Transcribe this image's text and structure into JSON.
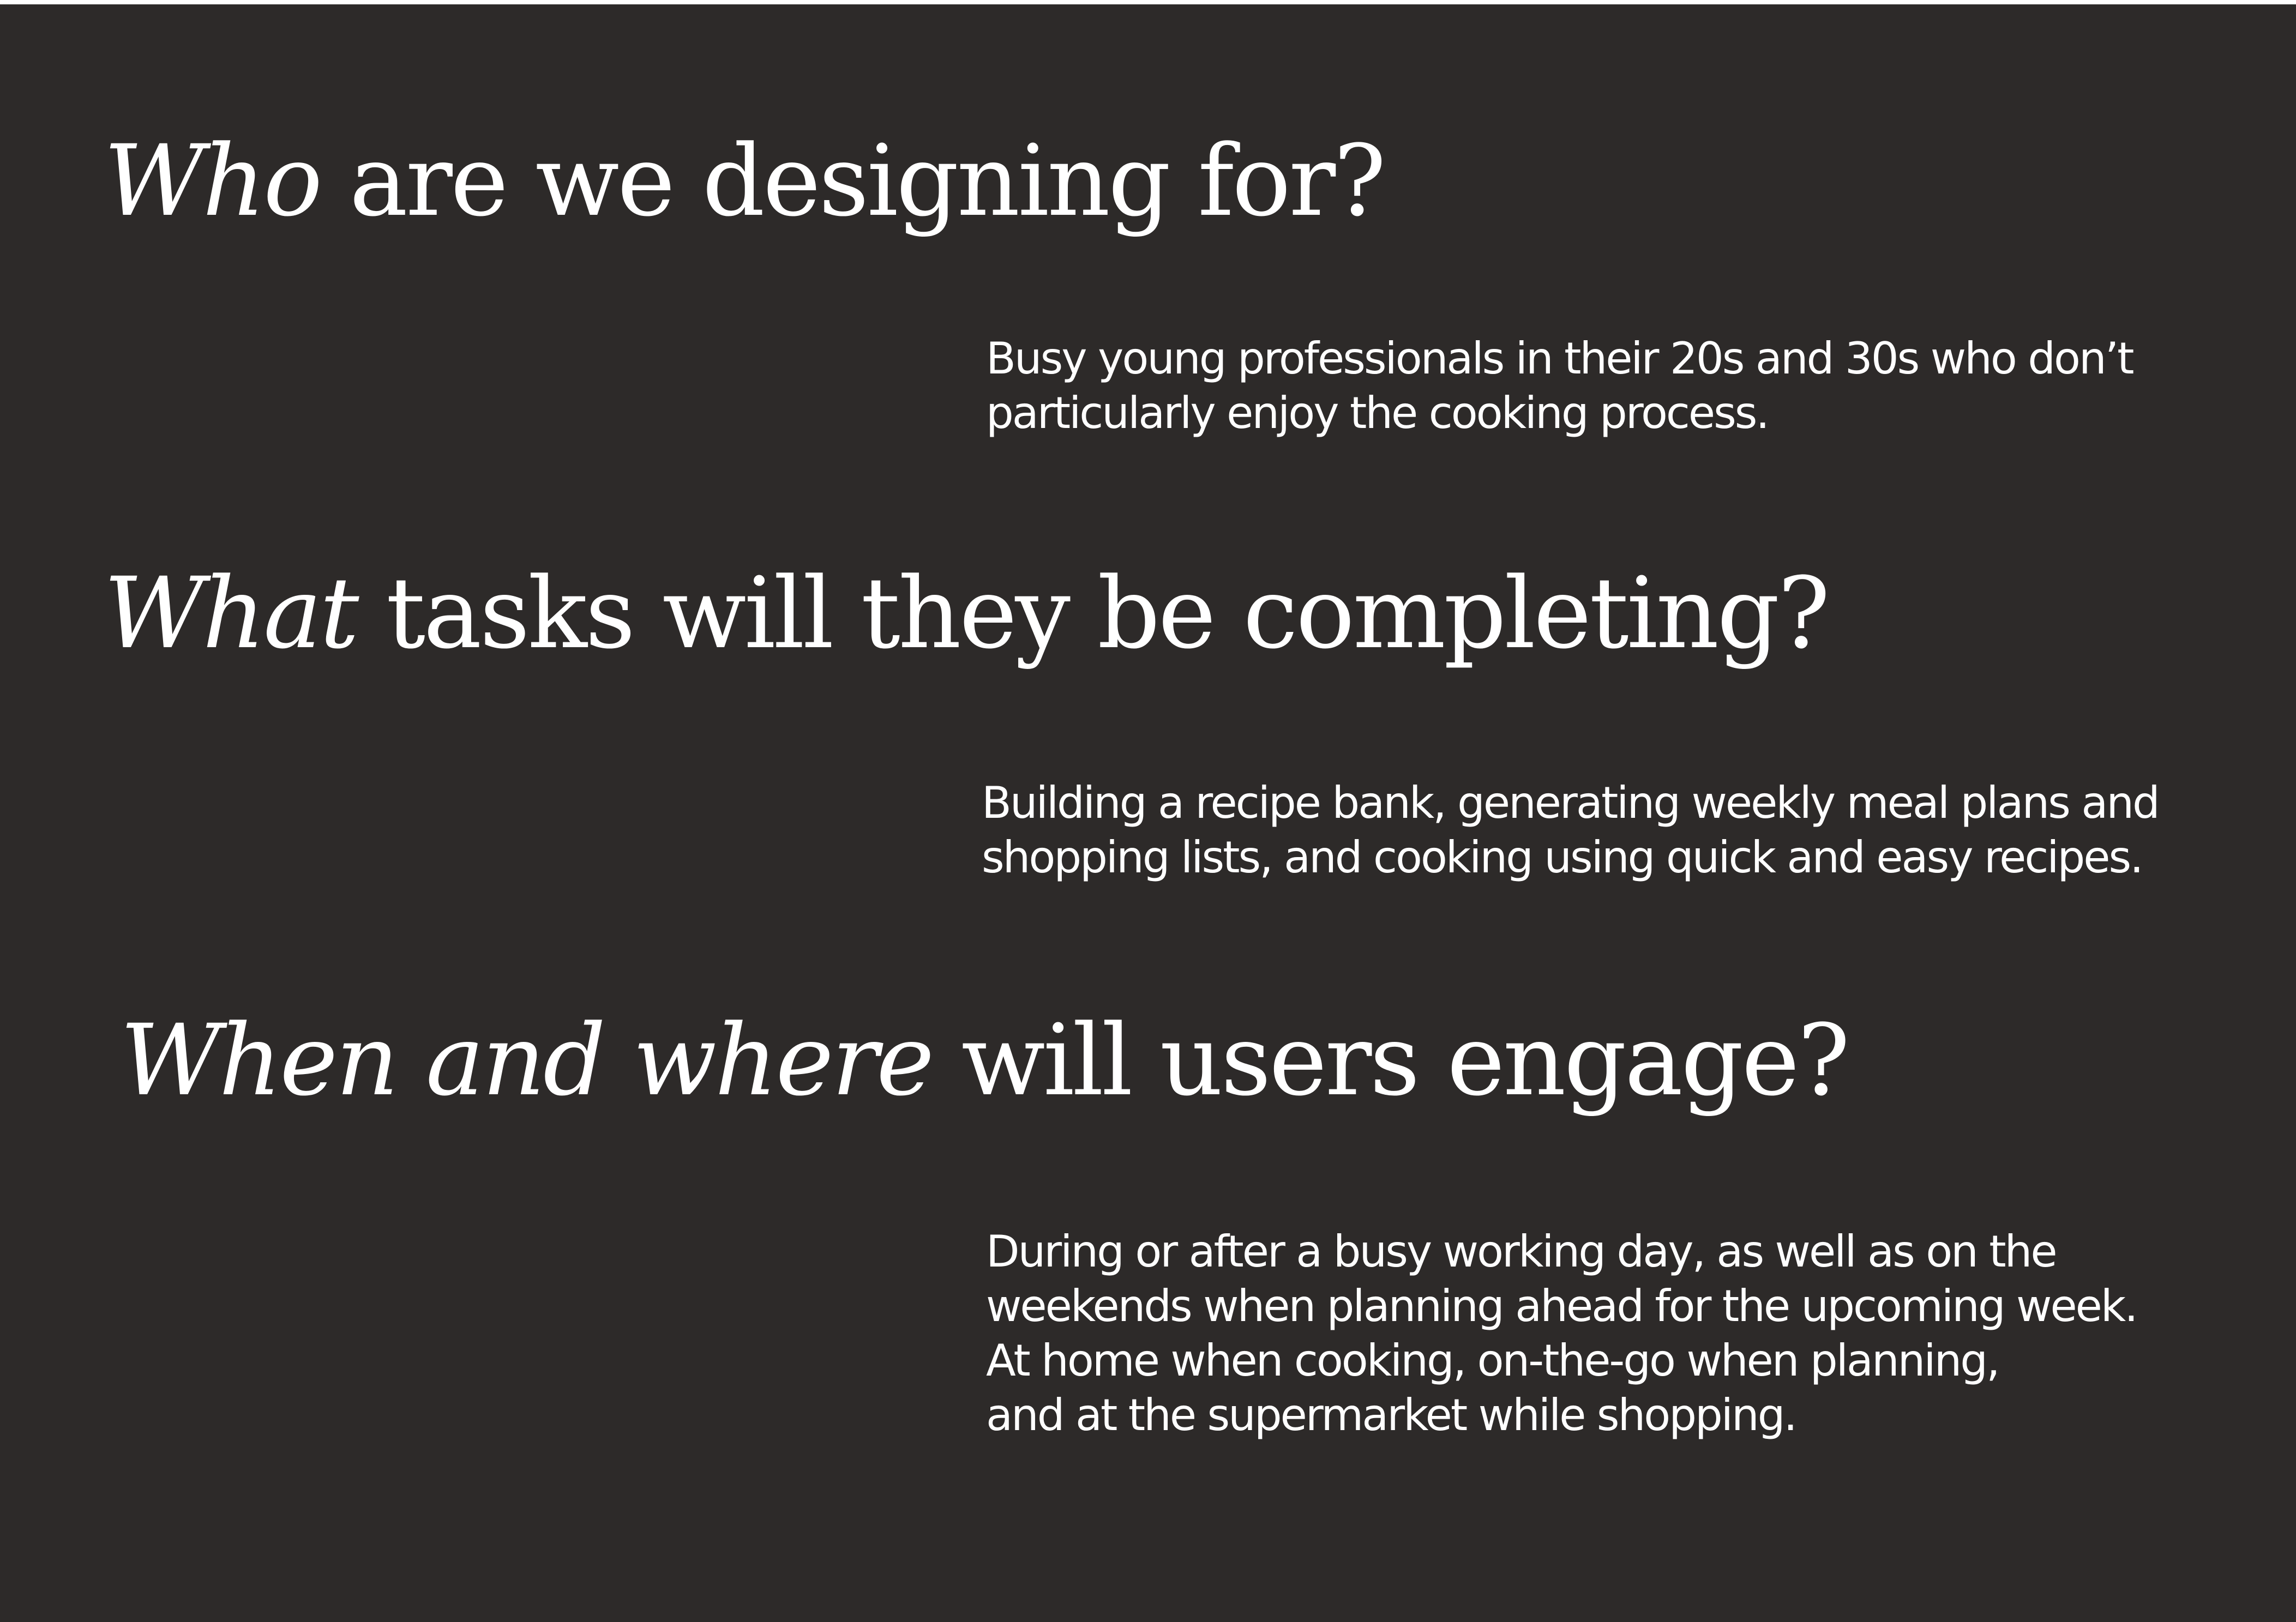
{
  "sections": [
    {
      "heading_italic": "Who",
      "heading_rest": " are we designing for?",
      "body_lines": [
        "Busy young professionals in their 20s and 30s who don’t",
        "particularly enjoy the cooking process."
      ]
    },
    {
      "heading_italic": "What",
      "heading_rest": " tasks will they be completing?",
      "body_lines": [
        "Building a recipe bank, generating weekly meal plans and",
        "shopping lists, and cooking using quick and easy recipes."
      ]
    },
    {
      "heading_italic": "When and where",
      "heading_rest": " will users engage?",
      "body_lines": [
        "During or after a busy working day, as well as on the",
        "weekends when planning ahead for the upcoming week.",
        "At home when cooking, on-the-go when planning,",
        "and at the supermarket while shopping."
      ]
    }
  ],
  "colors": {
    "background": "#2d2a29",
    "text": "#ffffff"
  }
}
